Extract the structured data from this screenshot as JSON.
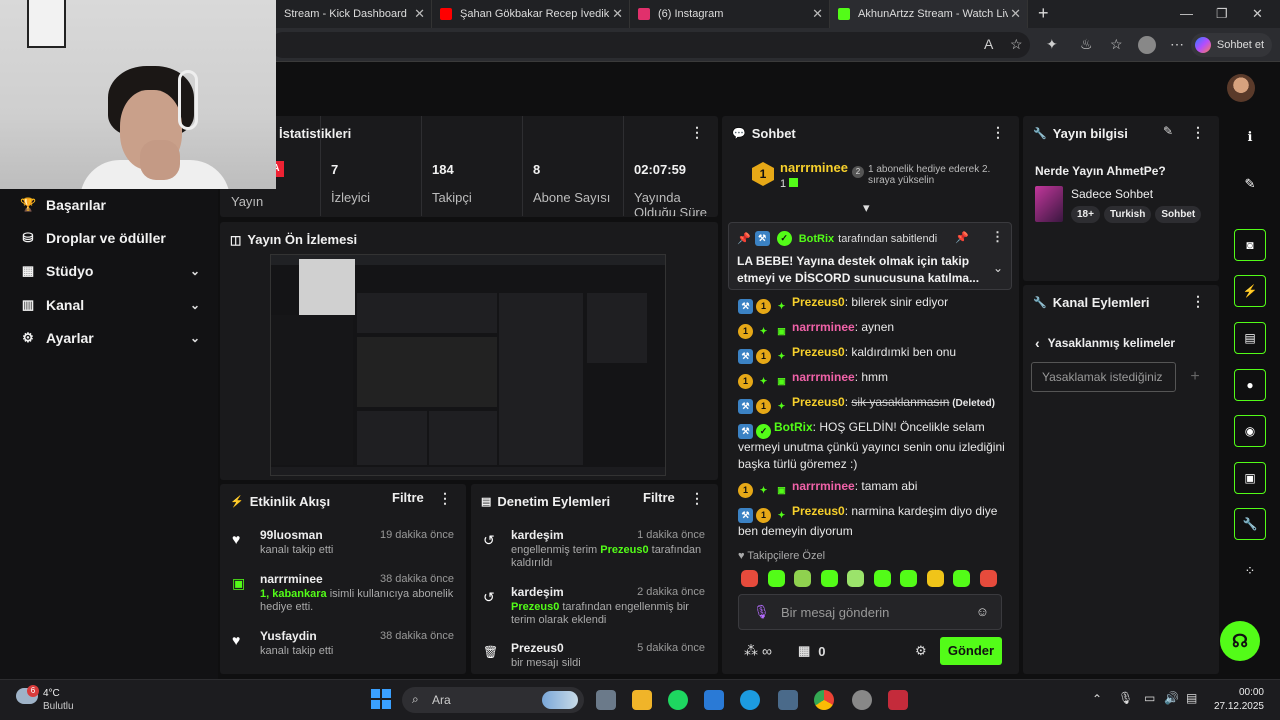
{
  "browser": {
    "tabs": [
      {
        "title": "Stream - Kick Dashboard",
        "color": "#53fc18"
      },
      {
        "title": "Şahan Gökbakar Recep İvedik Sah",
        "color": "#ff0000"
      },
      {
        "title": "(6) Instagram",
        "color": "#e1306c"
      },
      {
        "title": "AkhunArtzz Stream - Watch Live c",
        "color": "#53fc18"
      }
    ],
    "new_tab": "+",
    "sohbet_et": "Sohbet et"
  },
  "sidebar": {
    "items": [
      {
        "label": "Başarılar",
        "icon": "trophy-icon",
        "glyph": "🏆",
        "chevron": false
      },
      {
        "label": "Droplar ve ödüller",
        "icon": "gift-icon",
        "glyph": "⛁",
        "chevron": false
      },
      {
        "label": "Stüdyo",
        "icon": "studio-icon",
        "glyph": "▦",
        "chevron": true
      },
      {
        "label": "Kanal",
        "icon": "channel-icon",
        "glyph": "▥",
        "chevron": true
      },
      {
        "label": "Ayarlar",
        "icon": "gear-icon",
        "glyph": "⚙",
        "chevron": true
      }
    ]
  },
  "stats": {
    "title": "İstatistikleri",
    "live_label": "A",
    "live_text": "Yayın",
    "items": [
      {
        "value": "7",
        "label": "İzleyici"
      },
      {
        "value": "184",
        "label": "Takipçi"
      },
      {
        "value": "8",
        "label": "Abone Sayısı"
      },
      {
        "value": "02:07:59",
        "label": "Yayında Olduğu Süre"
      }
    ]
  },
  "preview": {
    "title": "Yayın Ön İzlemesi"
  },
  "activity": {
    "title": "Etkinlik Akışı",
    "filter": "Filtre",
    "items": [
      {
        "user": "99luosman",
        "time": "19 dakika önce",
        "desc": "kanalı takip etti",
        "icon": "heart-icon",
        "glyph": "♥"
      },
      {
        "user": "narrrminee",
        "time": "38 dakika önce",
        "desc_green": "1, kabankara",
        "desc": " isimli kullanıcıya abonelik hediye etti.",
        "icon": "gift-icon",
        "glyph": "▣"
      },
      {
        "user": "Yusfaydin",
        "time": "38 dakika önce",
        "desc": "kanalı takip etti",
        "icon": "heart-icon",
        "glyph": "♥"
      }
    ]
  },
  "moderation": {
    "title": "Denetim Eylemleri",
    "filter": "Filtre",
    "items": [
      {
        "term": "kardeşim",
        "time": "1 dakika önce",
        "pre": "engellenmiş terim ",
        "user": "Prezeus0",
        "post": " tarafından kaldırıldı",
        "icon": "undo-icon",
        "glyph": "↺"
      },
      {
        "term": "kardeşim",
        "time": "2 dakika önce",
        "pre": "",
        "user": "Prezeus0",
        "post": " tarafından engellenmiş bir terim olarak eklendi",
        "icon": "undo-icon",
        "glyph": "↺"
      },
      {
        "term": "Prezeus0",
        "time": "5 dakika önce",
        "pre": "bir mesajı sildi",
        "user": "",
        "post": "",
        "icon": "trash-icon",
        "glyph": "🗑"
      }
    ]
  },
  "chat": {
    "title": "Sohbet",
    "gifter": {
      "rank": "1",
      "name": "narrrminee",
      "count": "1",
      "rank2": "2",
      "text": "1 abonelik hediye ederek 2. sıraya yükselin"
    },
    "pinned": {
      "by": "BotRix",
      "by_suffix": " tarafından sabitlendi",
      "text": "LA BEBE! Yayına destek olmak için takip etmeyi ve DİSCORD sunucusuna katılma..."
    },
    "messages": [
      {
        "user": "Prezeus0",
        "color": "yellow",
        "badges": [
          "blue",
          "gold",
          "green4"
        ],
        "text": ": bilerek sinir ediyor"
      },
      {
        "user": "narrrminee",
        "color": "pink",
        "badges": [
          "gold",
          "green4",
          "sub"
        ],
        "text": ": aynen"
      },
      {
        "user": "Prezeus0",
        "color": "yellow",
        "badges": [
          "blue",
          "gold",
          "green4"
        ],
        "text": ": kaldırdımki ben onu"
      },
      {
        "user": "narrrminee",
        "color": "pink",
        "badges": [
          "gold",
          "green4",
          "sub"
        ],
        "text": ": hmm"
      },
      {
        "user": "Prezeus0",
        "color": "yellow",
        "badges": [
          "blue",
          "gold",
          "green4"
        ],
        "text": ": ",
        "strike": "sik yasaklanmasın",
        "deleted": " (Deleted)"
      },
      {
        "user": "BotRix",
        "color": "green",
        "badges": [
          "blue",
          "verified"
        ],
        "text": ": HOŞ GELDİN! Öncelikle selam vermeyi unutma çünkü yayıncı senin onu izlediğini başka türlü göremez :)"
      },
      {
        "user": "narrrminee",
        "color": "pink",
        "badges": [
          "gold",
          "green4",
          "sub"
        ],
        "text": ": tamam abi"
      },
      {
        "user": "Prezeus0",
        "color": "yellow",
        "badges": [
          "blue",
          "gold",
          "green4"
        ],
        "text": ": narmina kardeşim diyo diye ben demeyin diyorum"
      }
    ],
    "followers_only": "Takipçilere Özel",
    "emote_colors": [
      "#e64b3c",
      "#53fc18",
      "#8fd14f",
      "#53fc18",
      "#9be36b",
      "#53fc18",
      "#53fc18",
      "#f0c419",
      "#53fc18",
      "#e64b3c"
    ],
    "input_placeholder": "Bir mesaj gönderin",
    "infinity": "∞",
    "points": "0",
    "send": "Gönder"
  },
  "stream_info": {
    "title": "Yayın bilgisi",
    "stream_title": "Nerde Yayın AhmetPe?",
    "category": "Sadece Sohbet",
    "tags": [
      "18+",
      "Turkish",
      "Sohbet"
    ]
  },
  "channel_actions": {
    "title": "Kanal Eylemleri",
    "subtitle": "Yasaklanmış kelimeler",
    "input_placeholder": "Yasaklamak istediğiniz",
    "add": "+"
  },
  "taskbar": {
    "weather_temp": "4°C",
    "weather_desc": "Bulutlu",
    "weather_badge": "6",
    "search": "Ara",
    "time": "00:00",
    "date": "27.12.2025"
  }
}
